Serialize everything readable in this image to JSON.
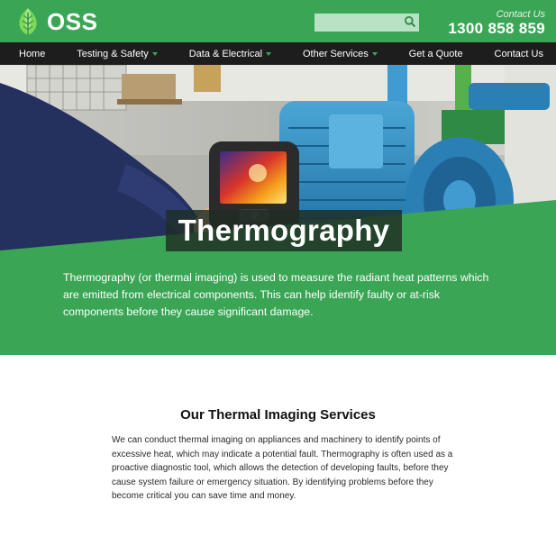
{
  "header": {
    "logo_text": "OSS",
    "search_placeholder": "",
    "contact_label": "Contact Us",
    "contact_phone": "1300 858 859"
  },
  "nav": {
    "items": [
      {
        "label": "Home",
        "has_dropdown": false
      },
      {
        "label": "Testing & Safety",
        "has_dropdown": true
      },
      {
        "label": "Data & Electrical",
        "has_dropdown": true
      },
      {
        "label": "Other Services",
        "has_dropdown": true
      },
      {
        "label": "Get a Quote",
        "has_dropdown": false
      },
      {
        "label": "Contact Us",
        "has_dropdown": false
      }
    ]
  },
  "hero": {
    "title": "Thermography",
    "description": "Thermography (or thermal imaging) is used to measure the radiant heat patterns which are emitted from electrical components. This can help identify faulty or at-risk components before they cause significant damage."
  },
  "services": {
    "title": "Our Thermal Imaging Services",
    "body": "We can conduct thermal imaging on appliances and machinery to identify points of excessive heat, which may indicate a potential fault. Thermography is often used as a proactive diagnostic tool, which allows the detection of developing faults, before they cause system failure or emergency situation. By identifying problems before they become critical you can save time and money."
  },
  "colors": {
    "brand_green": "#3aa655",
    "nav_background": "#1d1d1d",
    "search_background": "#b9e2c4"
  },
  "icons": {
    "logo": "leaf-icon",
    "search": "search-icon",
    "dropdown": "caret-down-icon"
  }
}
